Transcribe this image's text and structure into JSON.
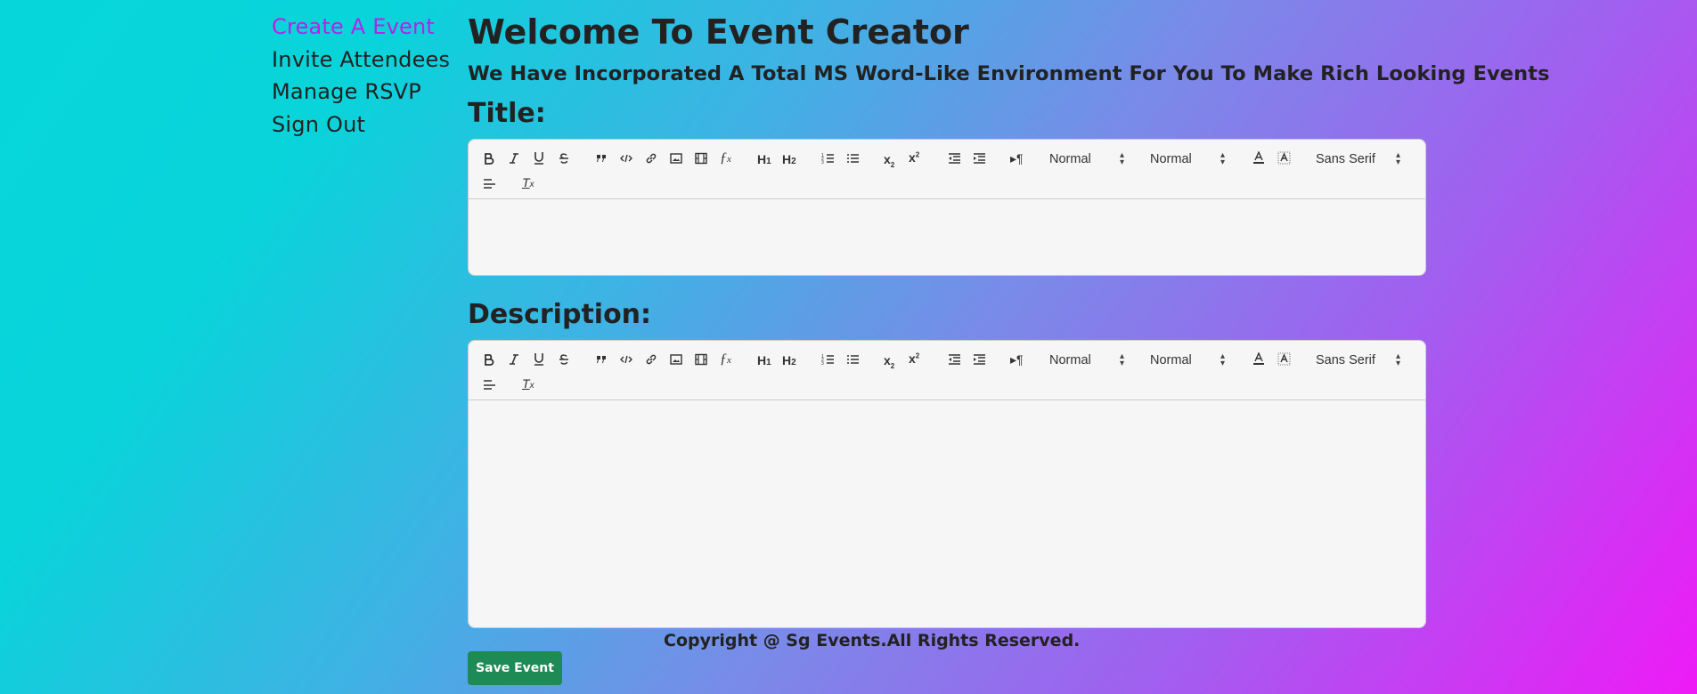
{
  "nav": {
    "items": [
      {
        "label": "Create A Event",
        "active": true
      },
      {
        "label": "Invite Attendees",
        "active": false
      },
      {
        "label": "Manage RSVP",
        "active": false
      },
      {
        "label": "Sign Out",
        "active": false
      }
    ]
  },
  "header": {
    "title": "Welcome To Event Creator",
    "subtitle": "We Have Incorporated A Total MS Word-Like Environment For You To Make Rich Looking Events"
  },
  "form": {
    "title_label": "Title:",
    "description_label": "Description:",
    "save_label": "Save Event"
  },
  "toolbar": {
    "buttons": [
      "bold-icon",
      "italic-icon",
      "underline-icon",
      "strike-icon",
      "blockquote-icon",
      "code-icon",
      "link-icon",
      "image-icon",
      "video-icon",
      "formula-icon",
      "header-1-icon",
      "header-2-icon",
      "ordered-list-icon",
      "bullet-list-icon",
      "subscript-icon",
      "superscript-icon",
      "outdent-icon",
      "indent-icon",
      "text-direction-icon",
      "text-color-icon",
      "background-color-icon",
      "align-icon",
      "clean-format-icon"
    ],
    "header_select": "Normal",
    "size_select": "Normal",
    "font_select": "Sans Serif"
  },
  "footer": {
    "copyright": "Copyright @ Sg Events.All Rights Reserved."
  },
  "colors": {
    "active_nav": "#b324e8",
    "save_button": "#1e8a55",
    "gradient_start": "#06d6d9",
    "gradient_end": "#ee1af6"
  }
}
